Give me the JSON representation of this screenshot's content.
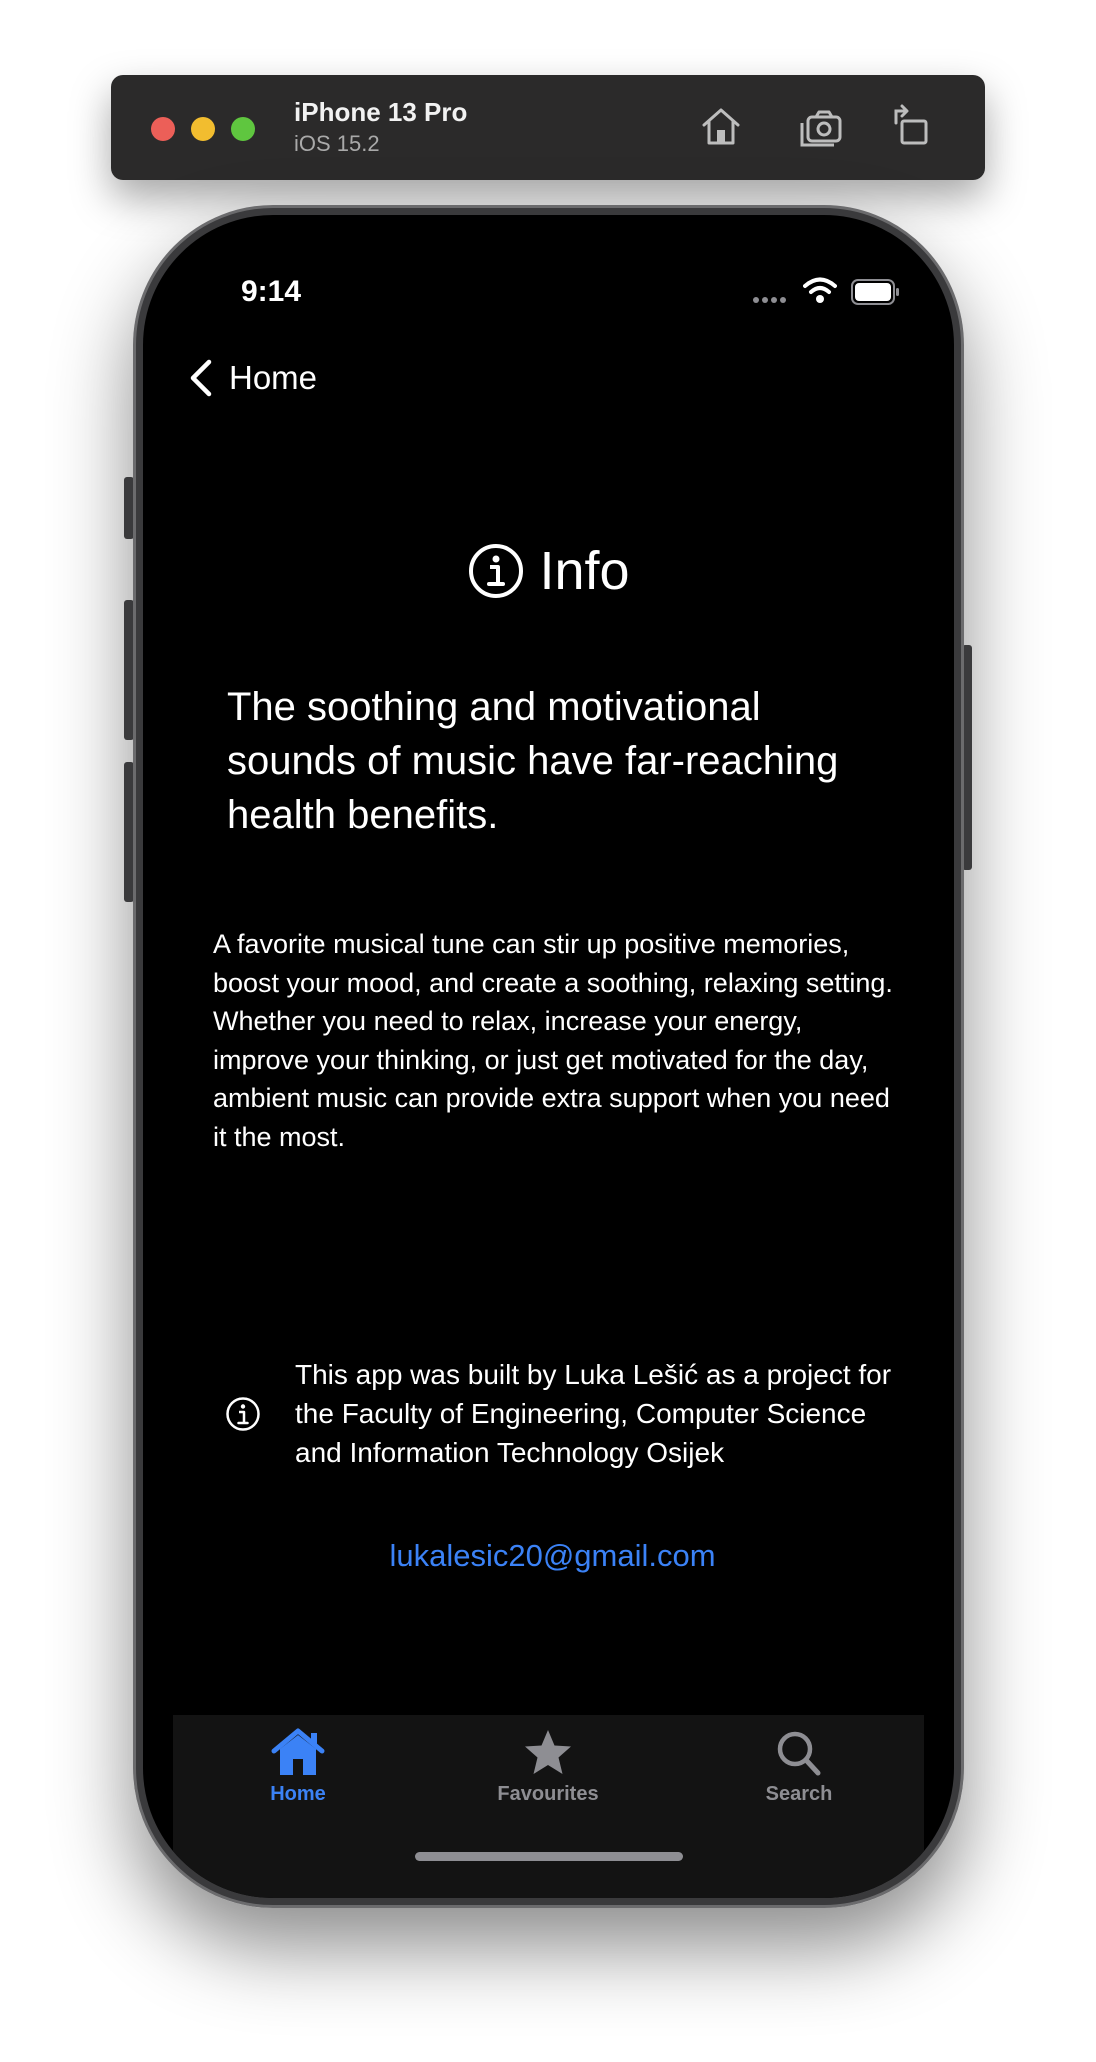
{
  "simulator": {
    "device_name": "iPhone 13 Pro",
    "os_version": "iOS 15.2",
    "toolbar_icons": [
      "home-icon",
      "screenshot-icon",
      "rotate-icon"
    ]
  },
  "status_bar": {
    "time": "9:14",
    "icons": [
      "cellular-signal-icon",
      "wifi-icon",
      "battery-icon"
    ]
  },
  "nav": {
    "back_label": "Home",
    "back_icon": "chevron-left-icon"
  },
  "page": {
    "title": "Info",
    "title_icon": "info-circle-icon",
    "headline": "The soothing and motivational sounds of music have far-reaching health benefits.",
    "body": "A favorite musical tune can stir up positive memories, boost your mood, and create a soothing, relaxing setting. Whether you need to relax, increase your energy, improve your thinking, or just get motivated for the day, ambient music can provide extra support when you need it the most.",
    "credit_icon": "info-circle-icon",
    "credit": "This app was built by Luka Lešić as a project for the Faculty of Engineering, Computer Science and Information Technology Osijek",
    "email": "lukalesic20@gmail.com"
  },
  "tabbar": {
    "items": [
      {
        "label": "Home",
        "icon": "house-icon",
        "selected": true
      },
      {
        "label": "Favourites",
        "icon": "star-icon",
        "selected": false
      },
      {
        "label": "Search",
        "icon": "magnifier-icon",
        "selected": false
      }
    ]
  },
  "colors": {
    "accent": "#3b82f6",
    "background": "#000000",
    "tabbar_background": "#131313",
    "inactive": "#8e8e93",
    "toolbar": "#2b2a2a"
  }
}
